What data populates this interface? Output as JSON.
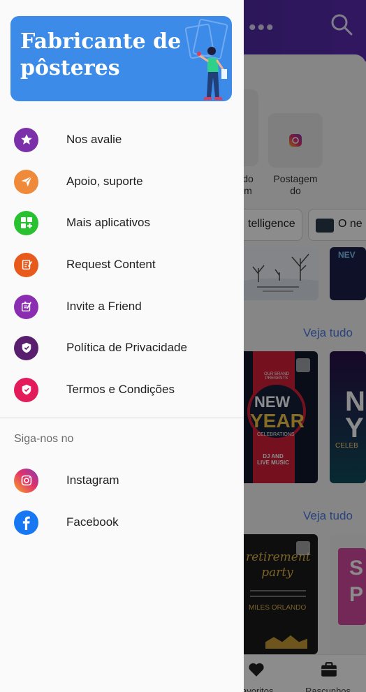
{
  "banner": {
    "title": "Fabricante de pôsteres"
  },
  "menu": [
    {
      "label": "Nos avalie",
      "icon": "star-icon",
      "color": "#7b2fa8"
    },
    {
      "label": "Apoio, suporte",
      "icon": "send-icon",
      "color": "#ef8a3a"
    },
    {
      "label": "Mais aplicativos",
      "icon": "apps-plus-icon",
      "color": "#29c12f"
    },
    {
      "label": "Request Content",
      "icon": "request-content-icon",
      "color": "#e85a1b"
    },
    {
      "label": "Invite a Friend",
      "icon": "invite-friend-icon",
      "color": "#8a2db0"
    },
    {
      "label": "Política de Privacidade",
      "icon": "privacy-shield-icon",
      "color": "#5a1e6e"
    },
    {
      "label": "Termos e Condições",
      "icon": "terms-shield-icon",
      "color": "#e31b5a"
    }
  ],
  "social": {
    "title": "Siga-nos no",
    "items": [
      {
        "label": "Instagram",
        "icon": "instagram-icon"
      },
      {
        "label": "Facebook",
        "icon": "facebook-icon",
        "color": "#1877f2"
      }
    ]
  },
  "background": {
    "cards": [
      {
        "label": "do\nm"
      },
      {
        "label": "Postagem\ndo"
      }
    ],
    "chips": [
      {
        "label": "telligence"
      },
      {
        "label": "O ne"
      }
    ],
    "see_all": [
      "Veja tudo",
      "Veja tudo"
    ],
    "poster_texts": {
      "new_year_top": "OUR BRAND PRESENTS",
      "new": "NEW",
      "year": "YEAR",
      "celebrations": "CELEBRATIONS",
      "dj": "DJ AND LIVE MUSIC",
      "retirement": "retirement party",
      "miles": "MILES ORLANDO",
      "partial_new": "NEV",
      "partial_n": "N",
      "partial_y": "Y",
      "celeb_partial": "CELEB",
      "s": "S",
      "p": "P"
    },
    "nav": [
      {
        "label": "avoritos",
        "icon": "heart-icon"
      },
      {
        "label": "Rascunhos",
        "icon": "briefcase-icon"
      }
    ]
  }
}
